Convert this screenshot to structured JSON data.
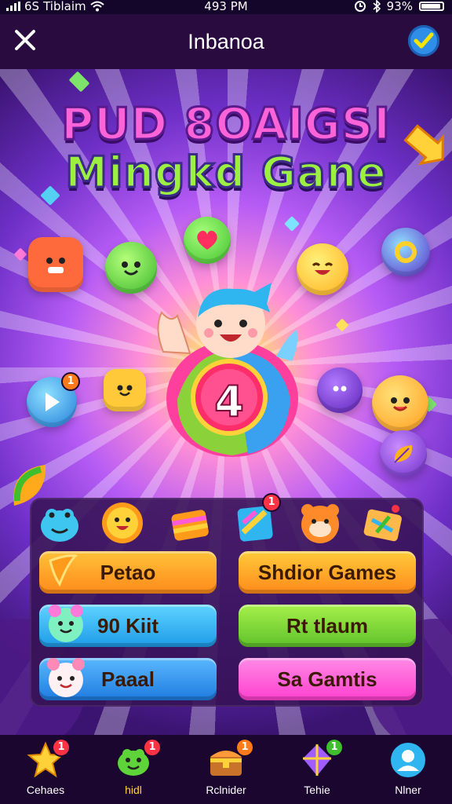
{
  "status_bar": {
    "carrier": "Tiblaim",
    "network": "6S",
    "time": "493 PM",
    "battery": "93%"
  },
  "header": {
    "title": "Inbanoa"
  },
  "hero": {
    "title_line1": "PUD 8OAIGSI",
    "title_line2": "Mingkd Gane",
    "center_number": "4",
    "badges": [
      "1"
    ]
  },
  "menu": {
    "buttons": [
      {
        "label": "Petao",
        "color": "#ff9a1a"
      },
      {
        "label": "Shdior Games",
        "color": "#ffa11f"
      },
      {
        "label": "90 Kiit",
        "color": "#2fb5f0"
      },
      {
        "label": "Rt tlaum",
        "color": "#77d82d"
      },
      {
        "label": "Paaal",
        "color": "#2d9cf0"
      },
      {
        "label": "Sa Gamtis",
        "color": "#ff5bd9"
      }
    ],
    "icon_badge": "1"
  },
  "nav": {
    "items": [
      {
        "label": "Cehaes",
        "badge": "1",
        "icon": "star-icon"
      },
      {
        "label": "hidl",
        "badge": "1",
        "icon": "green-blob-icon"
      },
      {
        "label": "Rclnider",
        "badge": "1",
        "icon": "treasure-chest-icon"
      },
      {
        "label": "Tehie",
        "badge": "1",
        "icon": "kite-icon"
      },
      {
        "label": "Nlner",
        "badge": "",
        "icon": "profile-icon"
      }
    ]
  },
  "colors": {
    "title_pink": "#ff63d8",
    "title_green": "#9cf042",
    "header_bg": "#2a0b3f",
    "nav_bg": "#1b0630",
    "badge_red": "#ff3344"
  }
}
